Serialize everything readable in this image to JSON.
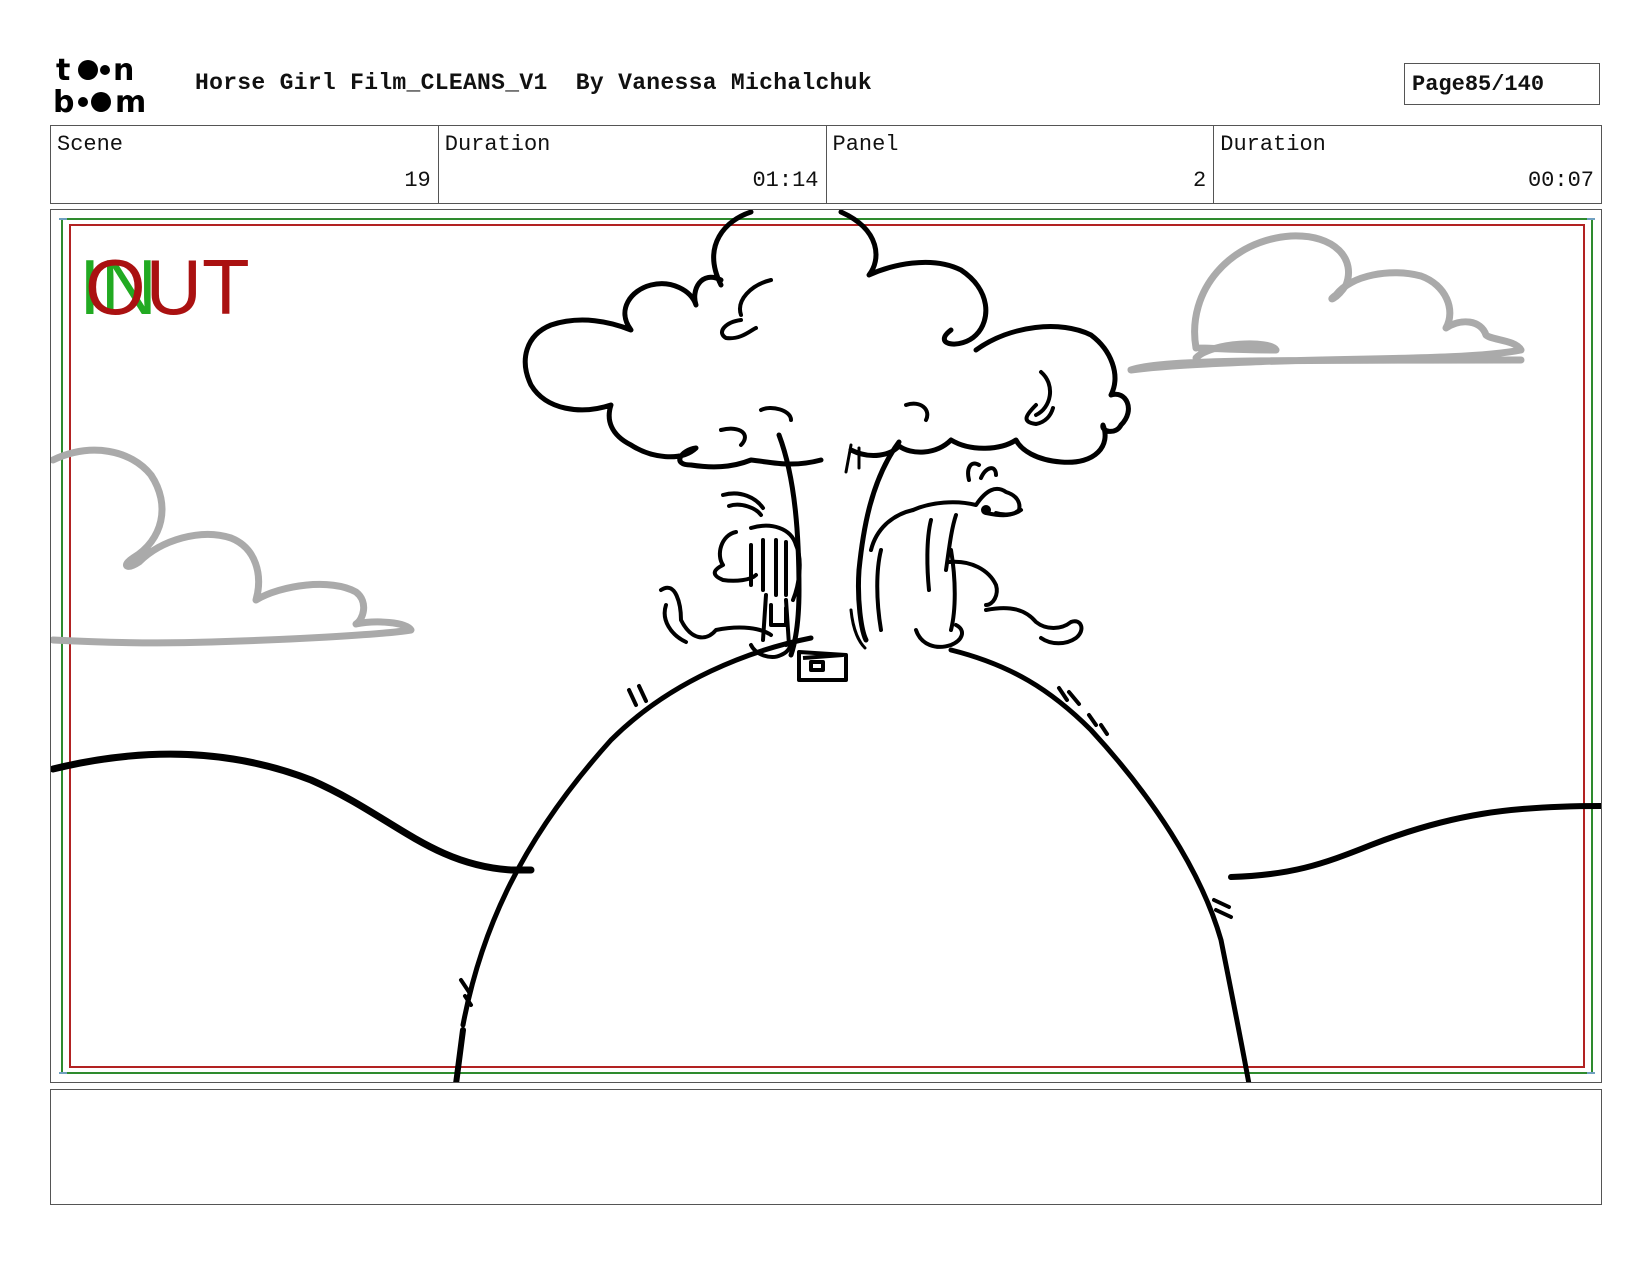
{
  "header": {
    "logo": "toon boom",
    "title": "Horse Girl Film_CLEANS_V1",
    "author": "By Vanessa Michalchuk",
    "page_label": "Page",
    "page_value": "85/140"
  },
  "info": {
    "scene_label": "Scene",
    "scene_value": "19",
    "scene_duration_label": "Duration",
    "scene_duration_value": "01:14",
    "panel_label": "Panel",
    "panel_value": "2",
    "panel_duration_label": "Duration",
    "panel_duration_value": "00:07"
  },
  "panel": {
    "in_marker": "IN",
    "out_marker": "OUT",
    "colors": {
      "in": "#22aa22",
      "out": "#aa1111",
      "safe_frame_green": "#2e8b2e",
      "safe_frame_red": "#b22222",
      "clouds": "#aaaaaa"
    }
  },
  "notes": {
    "text": ""
  }
}
